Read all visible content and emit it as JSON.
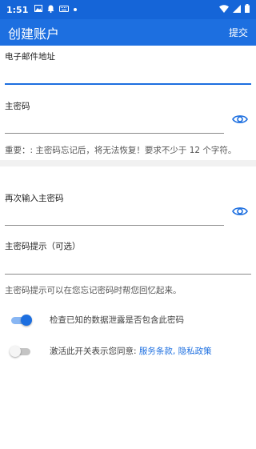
{
  "status_bar": {
    "time": "1:51",
    "icons_left": [
      "image-icon",
      "notification-icon",
      "keyboard-icon",
      "dot-icon"
    ],
    "icons_right": [
      "wifi-icon",
      "signal-icon",
      "battery-icon"
    ]
  },
  "app_bar": {
    "title": "创建账户",
    "submit_label": "提交"
  },
  "form": {
    "email_label": "电子邮件地址",
    "email_value": "",
    "master_password_label": "主密码",
    "master_password_value": "",
    "master_password_note": "重要：: 主密码忘记后，将无法恢复！要求不少于 12 个字符。",
    "retype_label": "再次输入主密码",
    "retype_value": "",
    "hint_label": "主密码提示（可选）",
    "hint_value": "",
    "hint_note": "主密码提示可以在您忘记密码时帮您回忆起来。"
  },
  "toggles": {
    "breach_check_label": "检查已知的数据泄露是否包含此密码",
    "breach_check_on": true,
    "terms_prefix": "激活此开关表示您同意:",
    "terms_link": "服务条款",
    "terms_separator": ",",
    "privacy_link": "隐私政策",
    "terms_on": false
  },
  "colors": {
    "primary": "#1d6fe0",
    "status_bar": "#1565d8"
  }
}
